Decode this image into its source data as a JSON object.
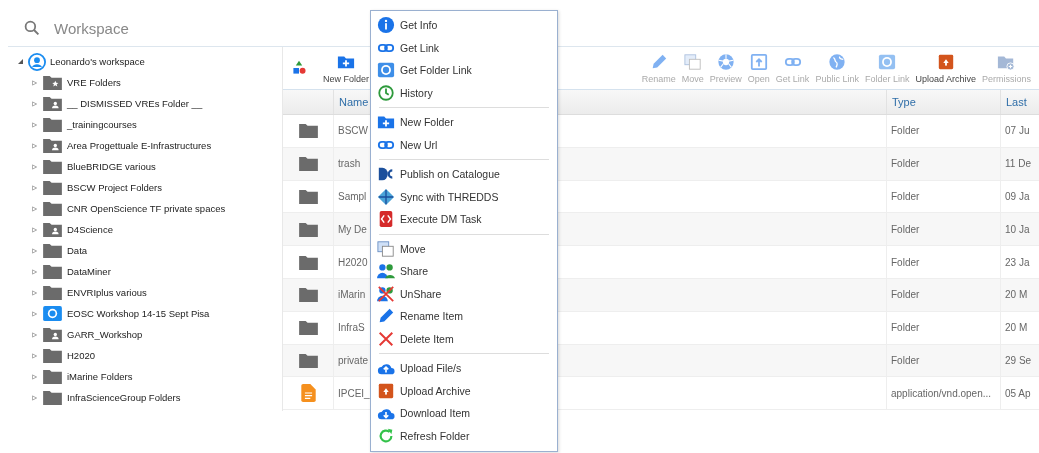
{
  "search": {
    "placeholder": "Workspace"
  },
  "tree": {
    "label": "Leonardo's workspace",
    "expanded": true,
    "children": [
      {
        "label": "VRE Folders",
        "kind": "vre",
        "expanded": false
      },
      {
        "label": "__ DISMISSED VREs Folder __",
        "kind": "shared",
        "expanded": false
      },
      {
        "label": "_trainingcourses",
        "kind": "folder",
        "expanded": false
      },
      {
        "label": "Area Progettuale E-Infrastructures",
        "kind": "shared",
        "expanded": false
      },
      {
        "label": "BlueBRIDGE various",
        "kind": "folder",
        "expanded": false
      },
      {
        "label": "BSCW Project Folders",
        "kind": "folder",
        "expanded": false
      },
      {
        "label": "CNR OpenScience TF private spaces",
        "kind": "folder",
        "expanded": false
      },
      {
        "label": "D4Science",
        "kind": "shared",
        "expanded": false
      },
      {
        "label": "Data",
        "kind": "folder",
        "expanded": false
      },
      {
        "label": "DataMiner",
        "kind": "folder",
        "expanded": false
      },
      {
        "label": "ENVRIplus various",
        "kind": "folder",
        "expanded": false
      },
      {
        "label": "EOSC Workshop 14-15 Sept Pisa",
        "kind": "public",
        "expanded": false
      },
      {
        "label": "GARR_Workshop",
        "kind": "shared",
        "expanded": false
      },
      {
        "label": "H2020",
        "kind": "folder",
        "expanded": false
      },
      {
        "label": "iMarine Folders",
        "kind": "folder",
        "expanded": false
      },
      {
        "label": "InfraScienceGroup Folders",
        "kind": "folder",
        "expanded": false
      }
    ]
  },
  "toolbar": {
    "left": [
      {
        "label": "New Folder",
        "disabled": false
      }
    ],
    "right": [
      {
        "label": "Rename",
        "disabled": true
      },
      {
        "label": "Move",
        "disabled": true
      },
      {
        "label": "Preview",
        "disabled": true
      },
      {
        "label": "Open",
        "disabled": true
      },
      {
        "label": "Get Link",
        "disabled": true
      },
      {
        "label": "Public Link",
        "disabled": true
      },
      {
        "label": "Folder Link",
        "disabled": true
      },
      {
        "label": "Upload Archive",
        "disabled": false
      },
      {
        "label": "Permissions",
        "disabled": true
      }
    ]
  },
  "table": {
    "columns": [
      "Name",
      "Type",
      "Last"
    ],
    "rows": [
      {
        "kind": "folder",
        "name": "BSCW",
        "type": "Folder",
        "last": "07 Ju"
      },
      {
        "kind": "folder",
        "name": "trash",
        "type": "Folder",
        "last": "11 De"
      },
      {
        "kind": "folder",
        "name": "Sampl",
        "type": "Folder",
        "last": "09 Ja"
      },
      {
        "kind": "folder",
        "name": "My De",
        "type": "Folder",
        "last": "10 Ja"
      },
      {
        "kind": "folder",
        "name": "H2020",
        "type": "Folder",
        "last": "23 Ja"
      },
      {
        "kind": "folder",
        "name": "iMarin",
        "type": "Folder",
        "last": "20 M"
      },
      {
        "kind": "folder",
        "name": "InfraS",
        "type": "Folder",
        "last": "20 M"
      },
      {
        "kind": "folder",
        "name": "private",
        "type": "Folder",
        "last": "29 Se"
      },
      {
        "kind": "file",
        "name": "IPCEI_",
        "type": "application/vnd.open...",
        "last": "05 Ap"
      }
    ]
  },
  "context_menu": {
    "groups": [
      [
        "Get Info",
        "Get Link",
        "Get Folder Link",
        "History"
      ],
      [
        "New Folder",
        "New Url"
      ],
      [
        "Publish on Catalogue",
        "Sync with THREDDS",
        "Execute DM Task"
      ],
      [
        "Move",
        "Share",
        "UnShare",
        "Rename Item",
        "Delete Item"
      ],
      [
        "Upload File/s",
        "Upload Archive",
        "Download Item",
        "Refresh Folder"
      ]
    ]
  }
}
